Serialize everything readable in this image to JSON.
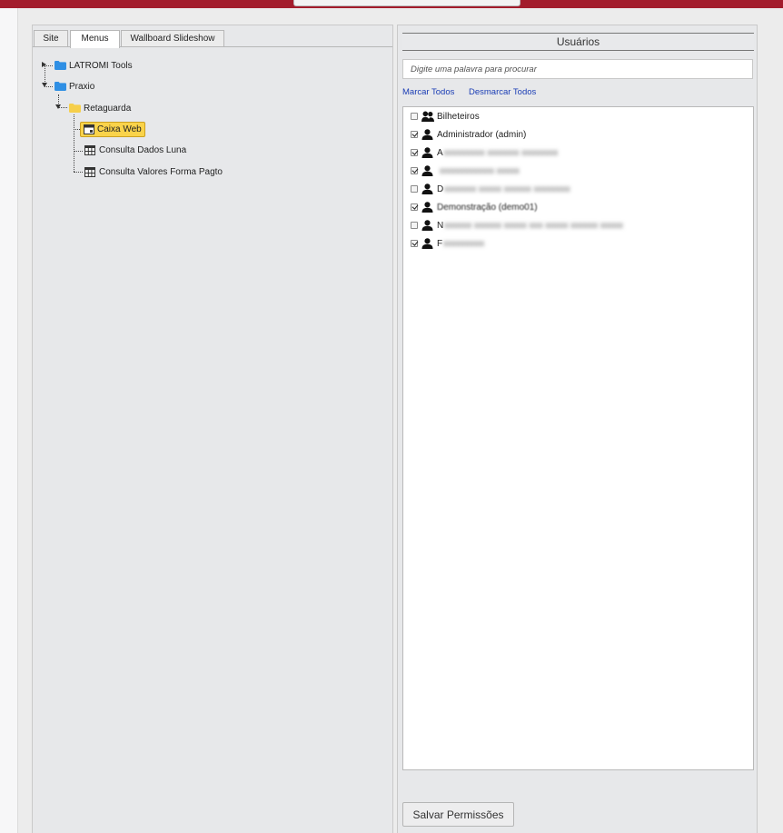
{
  "tabs": [
    {
      "label": "Site"
    },
    {
      "label": "Menus",
      "active": true
    },
    {
      "label": "Wallboard Slideshow"
    }
  ],
  "tree": {
    "latromi": "LATROMI Tools",
    "praxio": "Praxio",
    "retaguarda": "Retaguarda",
    "caixa": "Caixa Web",
    "consulta_luna": "Consulta Dados Luna",
    "consulta_valores": "Consulta Valores Forma Pagto"
  },
  "users_panel": {
    "title": "Usuários",
    "search_placeholder": "Digite uma palavra para procurar",
    "marcar_todos": "Marcar Todos",
    "desmarcar_todos": "Desmarcar Todos",
    "save_button": "Salvar Permissões"
  },
  "users": [
    {
      "label": "Bilheteiros",
      "checked": false,
      "icon": "users-group-icon"
    },
    {
      "label": "Administrador (admin)",
      "checked": true,
      "icon": "user-icon"
    },
    {
      "label": "A",
      "checked": true,
      "icon": "user-icon"
    },
    {
      "label": "",
      "checked": true,
      "icon": "user-icon"
    },
    {
      "label": "D",
      "checked": false,
      "icon": "user-icon"
    },
    {
      "label": "Demonstração (demo01)",
      "checked": true,
      "icon": "user-icon"
    },
    {
      "label": "N",
      "checked": false,
      "icon": "user-icon"
    },
    {
      "label": "F",
      "checked": true,
      "icon": "user-icon"
    }
  ],
  "colors": {
    "topbar": "#a31c2c",
    "selected_node": "#fad34a",
    "link": "#1a3db5",
    "folder_blue": "#2f8fe4",
    "folder_yellow": "#f6cf4b"
  }
}
